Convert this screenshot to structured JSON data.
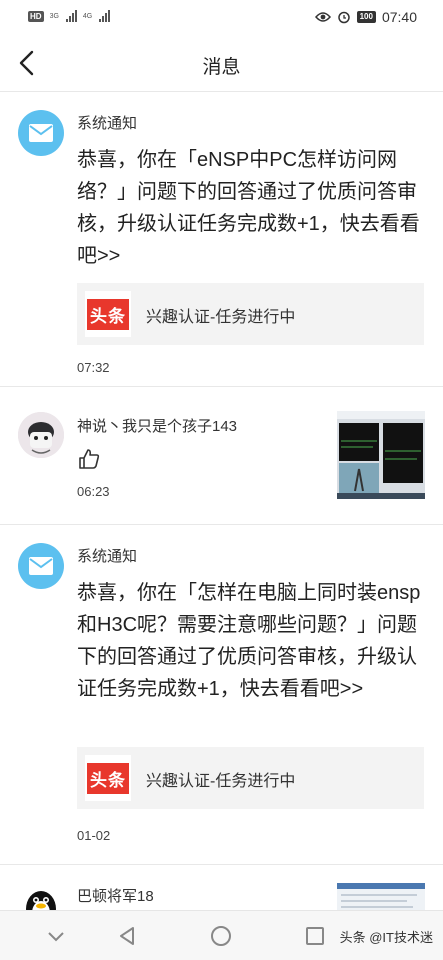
{
  "status_bar": {
    "hd": "HD",
    "net1": "3G",
    "net2": "4G",
    "battery": "100",
    "time": "07:40"
  },
  "header": {
    "title": "消息"
  },
  "messages": [
    {
      "sender": "系统通知",
      "text": "恭喜，你在「eNSP中PC怎样访问网络？」问题下的回答通过了优质问答审核，升级认证任务完成数+1，快去看看吧>>",
      "card_logo": "头条",
      "card_text": "兴趣认证-任务进行中",
      "time": "07:32"
    },
    {
      "sender": "神说丶我只是个孩子143",
      "time": "06:23"
    },
    {
      "sender": "系统通知",
      "text": "恭喜，你在「怎样在电脑上同时装ensp和H3C呢？需要注意哪些问题？」问题下的回答通过了优质问答审核，升级认证任务完成数+1，快去看看吧>>",
      "card_logo": "头条",
      "card_text": "兴趣认证-任务进行中",
      "time": "01-02"
    },
    {
      "sender": "巴顿将军18"
    }
  ],
  "watermark": "头条 @IT技术迷",
  "colors": {
    "system_avatar": "#5cc0ef",
    "toutiao_red": "#e8372c",
    "card_bg": "#f3f3f3"
  }
}
